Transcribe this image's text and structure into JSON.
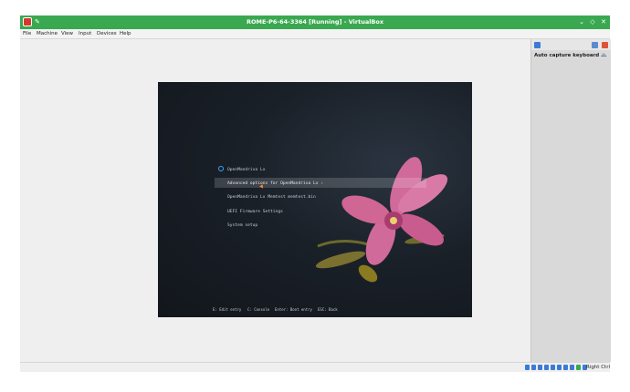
{
  "window": {
    "title": "ROME-P6-64-3364 [Running] - VirtualBox",
    "icons": {
      "app": "virtualbox-app-icon",
      "pin": "pin-icon",
      "minimize": "chevron-down-icon",
      "restore": "diamond-icon",
      "close": "close-icon"
    }
  },
  "menubar": {
    "items": [
      "File",
      "Machine",
      "View",
      "Input",
      "Devices",
      "Help"
    ]
  },
  "vm": {
    "boot_menu": {
      "items": [
        "OpenMandriva Lx",
        "Advanced options for OpenMandriva Lx ›",
        "OpenMandriva Lx Memtest memtest.bin",
        "UEFI Firmware Settings",
        "System setup"
      ],
      "selected_index": 1,
      "footer": [
        "E: Edit entry",
        "C: Console",
        "Enter: Boot entry",
        "ESC: Back"
      ]
    }
  },
  "side_panel": {
    "label": "Auto capture keyboard ..."
  },
  "statusbar": {
    "host_key": "Right Ctrl"
  },
  "colors": {
    "titlebar": "#3aa850",
    "accent": "#39a3ff",
    "selection": "#3b4048"
  }
}
